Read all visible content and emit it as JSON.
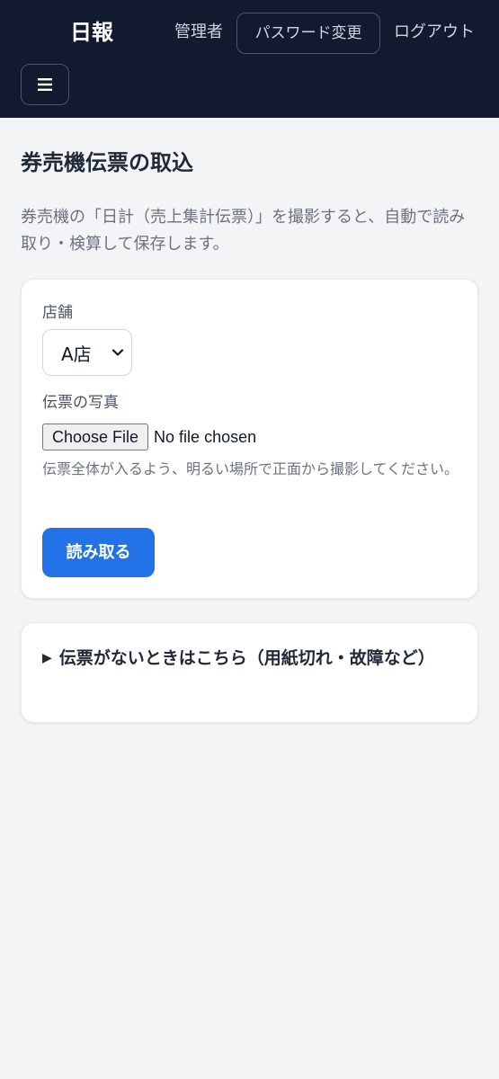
{
  "header": {
    "brand": "日報",
    "admin_label": "管理者",
    "password_label": "パスワード変更",
    "logout_label": "ログアウト",
    "menu_icon": "hamburger-menu-icon"
  },
  "page": {
    "title": "券売機伝票の取込",
    "description": "券売機の「日計（売上集計伝票）」を撮影すると、自動で読み取り・検算して保存します。"
  },
  "form": {
    "store_label": "店舗",
    "store_selected": "A店",
    "photo_label": "伝票の写真",
    "file_button_label": "Choose File",
    "file_status": "No file chosen",
    "hint": "伝票全体が入るよう、明るい場所で正面から撮影してください。",
    "submit_label": "読み取る"
  },
  "no_slip": {
    "summary": "伝票がないときはこちら（用紙切れ・故障など）"
  },
  "colors": {
    "header_bg": "#111a2e",
    "page_bg": "#f3f4f6",
    "primary_button": "#2472e8"
  }
}
